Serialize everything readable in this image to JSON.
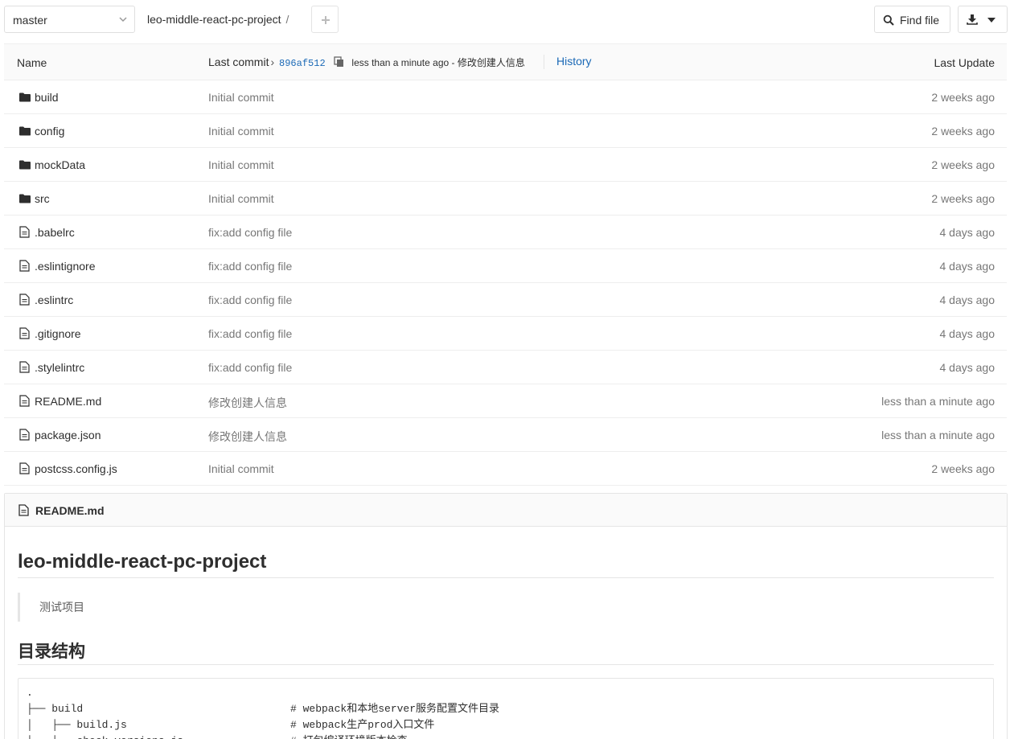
{
  "topbar": {
    "branch": "master",
    "project": "leo-middle-react-pc-project",
    "separator": "/",
    "find_file_label": "Find file"
  },
  "table": {
    "col_name": "Name",
    "col_last_commit": "Last commit",
    "commit_sha": "896af512",
    "commit_meta": "less than a minute ago - 修改创建人信息",
    "history_label": "History",
    "col_last_update": "Last Update",
    "rows": [
      {
        "name": "build",
        "type": "folder",
        "commit": "Initial commit",
        "updated": "2 weeks ago"
      },
      {
        "name": "config",
        "type": "folder",
        "commit": "Initial commit",
        "updated": "2 weeks ago"
      },
      {
        "name": "mockData",
        "type": "folder",
        "commit": "Initial commit",
        "updated": "2 weeks ago"
      },
      {
        "name": "src",
        "type": "folder",
        "commit": "Initial commit",
        "updated": "2 weeks ago"
      },
      {
        "name": ".babelrc",
        "type": "file",
        "commit": "fix:add config file",
        "updated": "4 days ago"
      },
      {
        "name": ".eslintignore",
        "type": "file",
        "commit": "fix:add config file",
        "updated": "4 days ago"
      },
      {
        "name": ".eslintrc",
        "type": "file",
        "commit": "fix:add config file",
        "updated": "4 days ago"
      },
      {
        "name": ".gitignore",
        "type": "file",
        "commit": "fix:add config file",
        "updated": "4 days ago"
      },
      {
        "name": ".stylelintrc",
        "type": "file",
        "commit": "fix:add config file",
        "updated": "4 days ago"
      },
      {
        "name": "README.md",
        "type": "file",
        "commit": "修改创建人信息",
        "updated": "less than a minute ago"
      },
      {
        "name": "package.json",
        "type": "file",
        "commit": "修改创建人信息",
        "updated": "less than a minute ago"
      },
      {
        "name": "postcss.config.js",
        "type": "file",
        "commit": "Initial commit",
        "updated": "2 weeks ago"
      }
    ]
  },
  "readme": {
    "filename": "README.md",
    "title": "leo-middle-react-pc-project",
    "quote": "测试项目",
    "section_title": "目录结构",
    "code_lines": [
      {
        "text": ".",
        "comment": ""
      },
      {
        "text": "├── build",
        "comment": "# webpack和本地server服务配置文件目录"
      },
      {
        "text": "│   ├── build.js",
        "comment": "# webpack生产prod入口文件"
      },
      {
        "text": "│   ├── check-versions.js",
        "comment": "# 打包编译环境版本检查"
      }
    ]
  },
  "colors": {
    "link": "#1b69b6",
    "muted": "#777777",
    "text": "#2e2e2e",
    "border": "#eeeeee",
    "header_bg": "#fafafa"
  }
}
